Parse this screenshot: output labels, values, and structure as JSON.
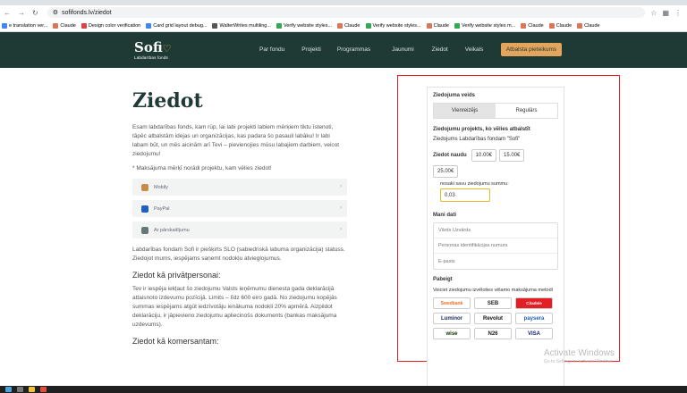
{
  "browser": {
    "url": "sofifonds.lv/ziedot",
    "bookmarks": [
      {
        "label": "e translation ver...",
        "color": "#4285f4"
      },
      {
        "label": "Claude",
        "color": "#d97757"
      },
      {
        "label": "Design color verification",
        "color": "#e04040"
      },
      {
        "label": "Card grid layout debug...",
        "color": "#4285f4"
      },
      {
        "label": "WalterWrites multiling...",
        "color": "#555555"
      },
      {
        "label": "Verify website styles...",
        "color": "#34a853"
      },
      {
        "label": "Claude",
        "color": "#d97757"
      },
      {
        "label": "Verify website styles...",
        "color": "#34a853"
      },
      {
        "label": "Claude",
        "color": "#d97757"
      },
      {
        "label": "Verify website styles m...",
        "color": "#34a853"
      },
      {
        "label": "Claude",
        "color": "#d97757"
      },
      {
        "label": "Claude",
        "color": "#d97757"
      },
      {
        "label": "Claude",
        "color": "#d97757"
      }
    ]
  },
  "header": {
    "logo_text": "Sofi",
    "logo_sub": "Labdarības fonds",
    "nav": [
      "Par fondu",
      "Projekti",
      "Programmas",
      "Jaunumi",
      "Ziedot",
      "Veikals"
    ],
    "cta": "Atbalsta pieteikums"
  },
  "main": {
    "title": "Ziedot",
    "intro": "Esam labdarības fonds, kam rūp, lai labi projekti labiem mērķiem tiktu īstenoti, tāpēc atbalstām idejas un organizācijas, kas padara šo pasauli labāku! Ir labi labam būt, un mēs aicinām arī Tevi – pievienojies mūsu labajiem darbiem, veicot ziedojumu!",
    "note": "* Maksājuma mērķī norādi projektu, kam vēlies ziedot!",
    "methods": [
      {
        "label": "Mobily",
        "icon": "mobily-icon",
        "color": "#c98c4a"
      },
      {
        "label": "PayPal",
        "icon": "paypal-icon",
        "color": "#1f5fbf"
      },
      {
        "label": "Ar pārskaitījumu",
        "icon": "transfer-icon",
        "color": "#667777"
      }
    ],
    "status_text": "Labdarības fondam Sofi ir piešķirts SLO (sabiedriskā labuma organizācija) statuss. Ziedojot mums, iespējams saņemt nodokļu atvieglojumus.",
    "private_heading": "Ziedot kā privātpersonai:",
    "private_text": "Tev ir iespēja iekļaut šo ziedojumu Valsts ieņēmumu dienesta gada deklarācijā attaisnoto izdevumu pozīcijā. Limits – līdz 600 eiro gadā. No ziedojumu kopējās summas iespējams atgūt iedzīvotāju ienākuma nodokli 20% apmērā. Aizpildot deklarāciju, ir jāpievieno ziedojumu apliecinošs dokuments (bankas maksājuma uzdevums).",
    "company_heading": "Ziedot kā komersantam:"
  },
  "form": {
    "type_label": "Ziedojuma veids",
    "type_options": [
      "Vienreizējs",
      "Regulārs"
    ],
    "project_label": "Ziedojumu projekts, ko vēlies atbalstīt",
    "project_value": "Ziedojums Labdarības fondam \"Sofi\"",
    "amount_label": "Ziedot naudu",
    "amounts": [
      "10.00€",
      "15.00€",
      "25.00€"
    ],
    "custom_label": "nosaki savu ziedojumu summu:",
    "custom_value": "0,03",
    "data_label": "Mani dati",
    "fields": [
      "Vārds Uzvārds",
      "Personas identifikācijas numurs",
      "E-pasts"
    ],
    "finish_label": "Pabeigt",
    "finish_text": "Veiciet ziedojumu izvēloties vēlamo maksājuma metodi",
    "banks": [
      "Swedbank",
      "SEB",
      "Citadele",
      "Luminor",
      "Revolut",
      "paysera",
      "wise",
      "N26",
      "VISA"
    ]
  },
  "os": {
    "watermark": "Activate Windows",
    "watermark_sub": "Go to Settings to activate Windows."
  }
}
